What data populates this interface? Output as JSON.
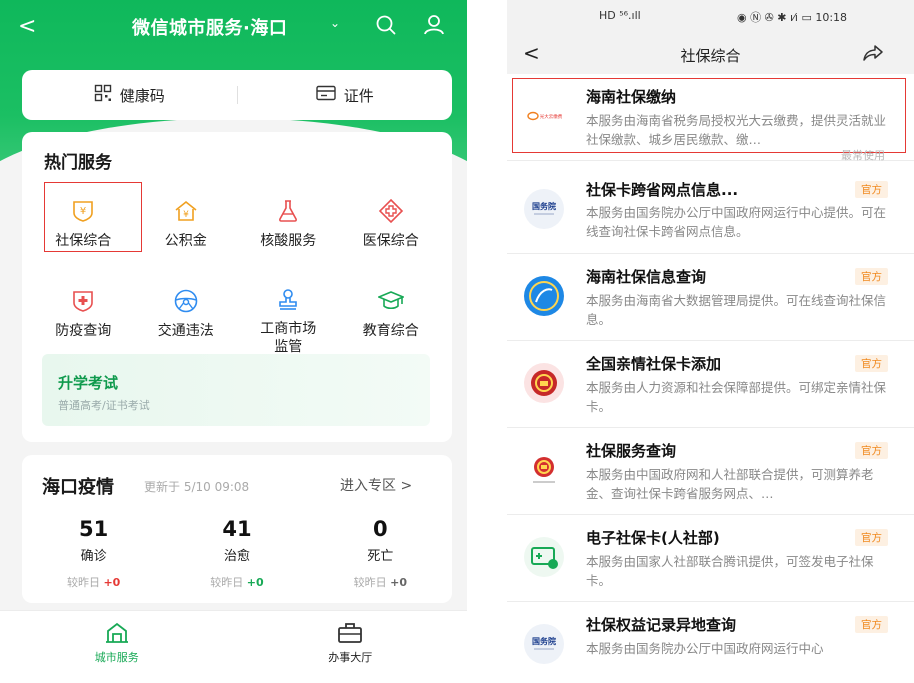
{
  "left": {
    "header": {
      "back": "<",
      "title": "微信城市服务·海口",
      "title_chevron": "⌄"
    },
    "id_card": {
      "health_code": "健康码",
      "certificate": "证件"
    },
    "hot_services": {
      "heading": "热门服务",
      "items": [
        {
          "label": "社保综合",
          "icon": "yuan-shield-icon",
          "color": "#f0a020"
        },
        {
          "label": "公积金",
          "icon": "house-yuan-icon",
          "color": "#f0a020"
        },
        {
          "label": "核酸服务",
          "icon": "flask-icon",
          "color": "#e85050"
        },
        {
          "label": "医保综合",
          "icon": "medical-cross-icon",
          "color": "#e85050"
        },
        {
          "label": "防疫查询",
          "icon": "health-shield-icon",
          "color": "#e85050"
        },
        {
          "label": "交通违法",
          "icon": "steering-wheel-icon",
          "color": "#2f8cf0"
        },
        {
          "label": "工商市场\n监管",
          "icon": "stamp-icon",
          "color": "#2f8cf0"
        },
        {
          "label": "教育综合",
          "icon": "graduation-cap-icon",
          "color": "#18a956"
        }
      ],
      "exam": {
        "title": "升学考试",
        "subtitle": "普通高考/证书考试"
      }
    },
    "epidemic": {
      "title": "海口疫情",
      "updated": "更新于 5/10 09:08",
      "enter": "进入专区 >",
      "stats": [
        {
          "value": "51",
          "label": "确诊",
          "delta_label": "较昨日",
          "delta": "+0",
          "delta_color": "#e53935"
        },
        {
          "value": "41",
          "label": "治愈",
          "delta_label": "较昨日",
          "delta": "+0",
          "delta_color": "#18a956"
        },
        {
          "value": "0",
          "label": "死亡",
          "delta_label": "较昨日",
          "delta": "+0",
          "delta_color": "#666666"
        }
      ]
    },
    "tabbar": {
      "city_service": "城市服务",
      "office_hall": "办事大厅"
    }
  },
  "right": {
    "status_bar": {
      "left": "HD ⁵⁶.ıll",
      "right": "◉ Ⓝ ✇ ✱ ı⁄ı ▭ 10:18"
    },
    "nav": {
      "back": "<",
      "title": "社保综合"
    },
    "items": [
      {
        "name": "海南社保缴纳",
        "desc": "本服务由海南省税务局授权光大云缴费，提供灵活就业社保缴款、城乡居民缴款、缴…",
        "badge": "",
        "recent": "最常使用"
      },
      {
        "name": "社保卡跨省网点信息...",
        "desc": "本服务由国务院办公厅中国政府网运行中心提供。可在线查询社保卡跨省网点信息。",
        "badge": "官方"
      },
      {
        "name": "海南社保信息查询",
        "desc": "本服务由海南省大数据管理局提供。可在线查询社保信息。",
        "badge": "官方"
      },
      {
        "name": "全国亲情社保卡添加",
        "desc": "本服务由人力资源和社会保障部提供。可绑定亲情社保卡。",
        "badge": "官方"
      },
      {
        "name": "社保服务查询",
        "desc": "本服务由中国政府网和人社部联合提供，可测算养老金、查询社保卡跨省服务网点、…",
        "badge": "官方"
      },
      {
        "name": "电子社保卡(人社部)",
        "desc": "本服务由国家人社部联合腾讯提供，可签发电子社保卡。",
        "badge": "官方"
      },
      {
        "name": "社保权益记录异地查询",
        "desc": "本服务由国务院办公厅中国政府网运行中心",
        "badge": "官方"
      }
    ],
    "avatar_texts": {
      "item0": "光大云缴费",
      "item1": "国务院",
      "item6": "国务院"
    }
  }
}
